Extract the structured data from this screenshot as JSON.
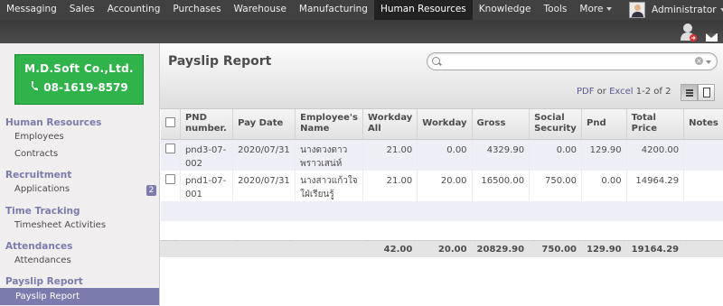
{
  "topnav": {
    "items": [
      "Messaging",
      "Sales",
      "Accounting",
      "Purchases",
      "Warehouse",
      "Manufacturing",
      "Human Resources",
      "Knowledge",
      "Tools",
      "More"
    ],
    "active_index": 6,
    "user": "Administrator"
  },
  "logo": {
    "company": "M.D.Soft Co.,Ltd.",
    "phone": "08-1619-8579"
  },
  "sidebar": {
    "hr_title": "Human Resources",
    "employees": "Employees",
    "contracts": "Contracts",
    "recruitment_title": "Recruitment",
    "applications": "Applications",
    "applications_count": "2",
    "tracking_title": "Time Tracking",
    "timesheet": "Timesheet Activities",
    "attendances_title": "Attendances",
    "attendances": "Attendances",
    "payslip_title": "Payslip Report",
    "payslip_report": "Payslip Report"
  },
  "view": {
    "title": "Payslip Report",
    "search_placeholder": "",
    "pdf": "PDF",
    "or": "or",
    "excel": "Excel",
    "pager": "1-2 of 2"
  },
  "table": {
    "columns": [
      "PND number.",
      "Pay Date",
      "Employee's Name",
      "Workday All",
      "Workday",
      "Gross",
      "Social Security",
      "Pnd",
      "Total Price",
      "Notes"
    ],
    "rows": [
      [
        "pnd3-07-002",
        "2020/07/31",
        "นางดวงดาว พราวเสน่ห์",
        "21.00",
        "0.00",
        "4329.90",
        "0.00",
        "129.90",
        "4200.00",
        ""
      ],
      [
        "pnd1-07-001",
        "2020/07/31",
        "นางสาวแก้วใจ ใฝ่เรียนรู้",
        "21.00",
        "20.00",
        "16500.00",
        "750.00",
        "0.00",
        "14964.29",
        ""
      ]
    ],
    "totals": [
      "",
      "",
      "",
      "42.00",
      "20.00",
      "20829.90",
      "750.00",
      "129.90",
      "19164.29",
      ""
    ]
  },
  "colors": {
    "topbar": "#414141",
    "accent": "#7c7bad",
    "logo_green": "#2fb34a"
  }
}
